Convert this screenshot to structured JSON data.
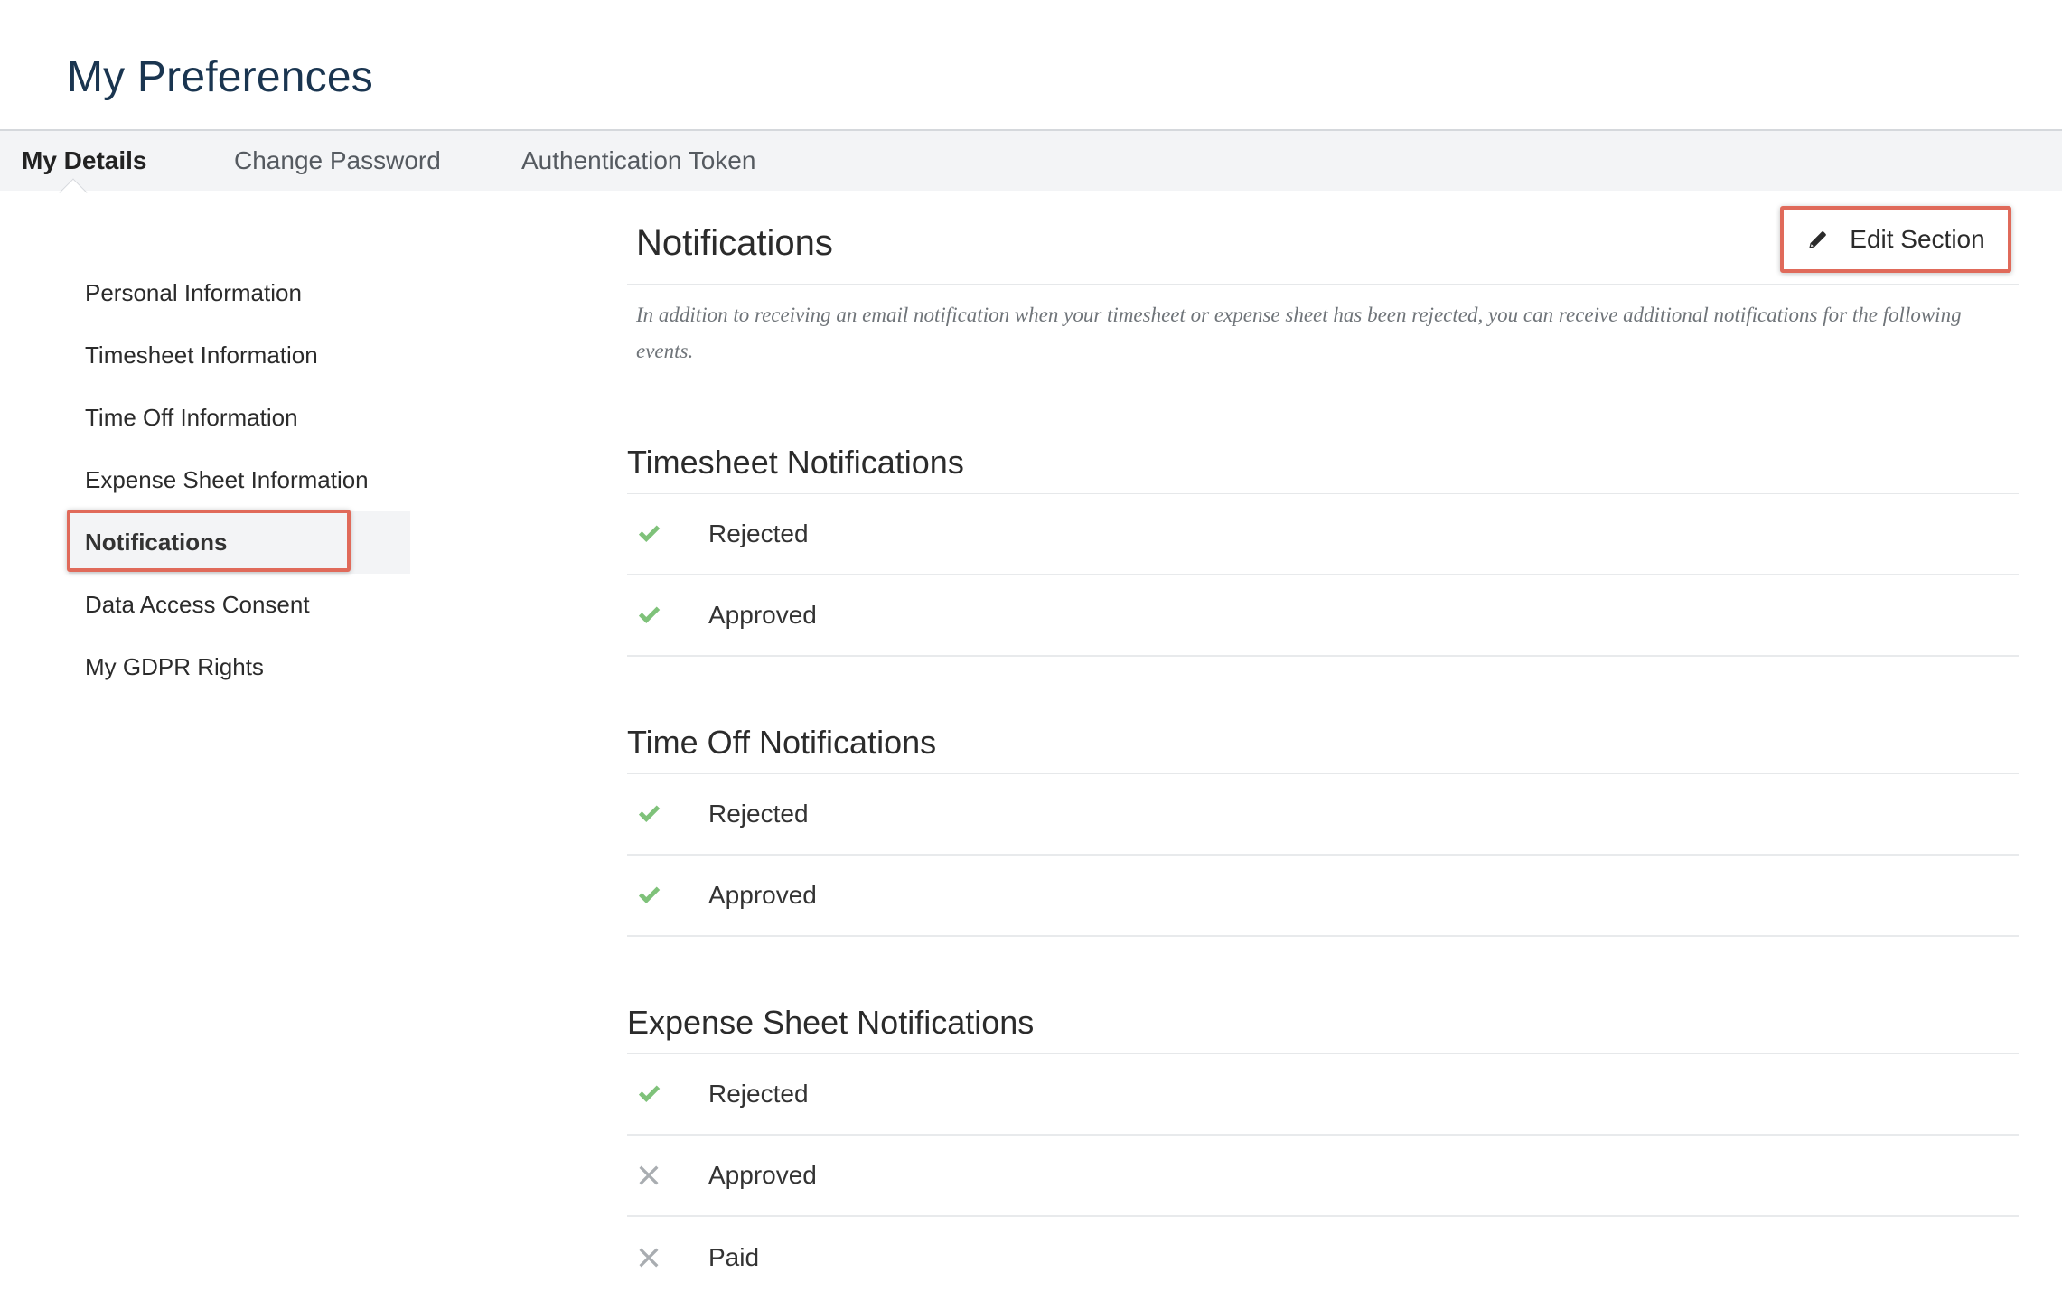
{
  "header": {
    "title": "My Preferences"
  },
  "tabs": [
    {
      "label": "My Details",
      "active": true
    },
    {
      "label": "Change Password",
      "active": false
    },
    {
      "label": "Authentication Token",
      "active": false
    }
  ],
  "sidebar": {
    "items": [
      {
        "label": "Personal Information"
      },
      {
        "label": "Timesheet Information"
      },
      {
        "label": "Time Off Information"
      },
      {
        "label": "Expense Sheet Information"
      },
      {
        "label": "Notifications",
        "active": true
      },
      {
        "label": "Data Access Consent"
      },
      {
        "label": "My GDPR Rights"
      }
    ]
  },
  "main": {
    "section_title": "Notifications",
    "edit_button": "Edit Section",
    "description": "In addition to receiving an email notification when your timesheet or expense sheet has been rejected, you can receive additional notifications for the following events.",
    "groups": [
      {
        "title": "Timesheet Notifications",
        "rows": [
          {
            "label": "Rejected",
            "enabled": true,
            "icon": "check-icon"
          },
          {
            "label": "Approved",
            "enabled": true,
            "icon": "check-icon"
          }
        ]
      },
      {
        "title": "Time Off Notifications",
        "rows": [
          {
            "label": "Rejected",
            "enabled": true,
            "icon": "check-icon"
          },
          {
            "label": "Approved",
            "enabled": true,
            "icon": "check-icon"
          }
        ]
      },
      {
        "title": "Expense Sheet Notifications",
        "rows": [
          {
            "label": "Rejected",
            "enabled": true,
            "icon": "check-icon"
          },
          {
            "label": "Approved",
            "enabled": false,
            "icon": "cross-icon"
          },
          {
            "label": "Paid",
            "enabled": false,
            "icon": "cross-icon"
          }
        ]
      }
    ]
  },
  "colors": {
    "title": "#1a3550",
    "highlight": "#e06a5a",
    "check": "#7fc27a",
    "cross": "#a9adb1",
    "tabbar": "#f3f4f6"
  }
}
